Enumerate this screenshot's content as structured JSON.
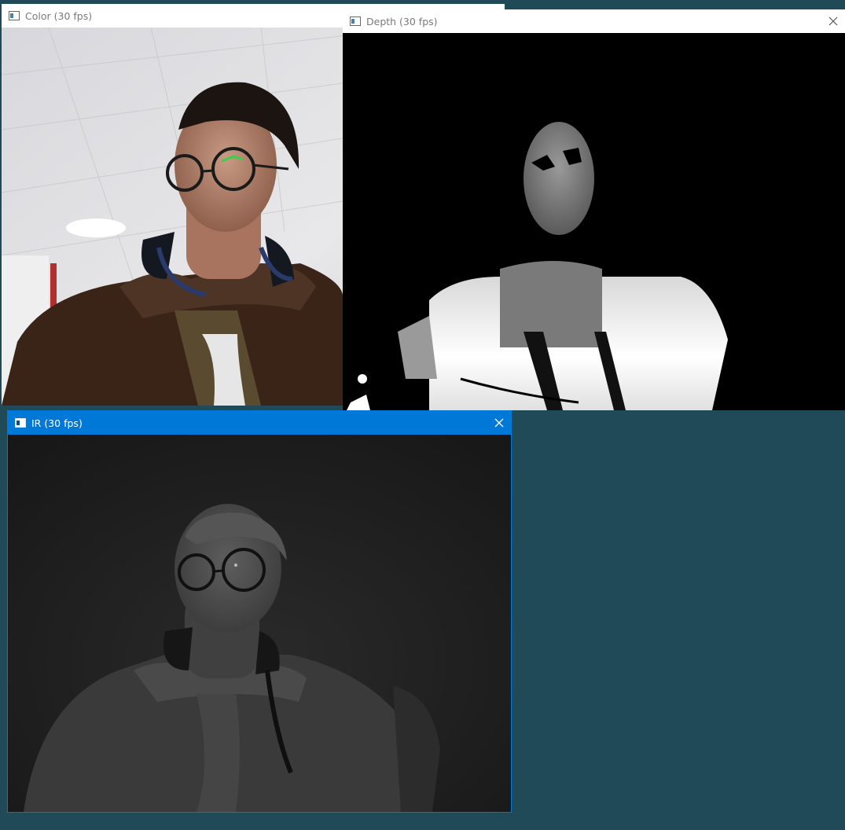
{
  "desktop": {
    "background_color": "#214a58"
  },
  "windows": {
    "color": {
      "title": "Color (30 fps)",
      "icon": "window-app-icon"
    },
    "depth": {
      "title": "Depth (30 fps)",
      "icon": "window-app-icon",
      "close_icon": "close-icon"
    },
    "ir": {
      "title": "IR (30 fps)",
      "icon": "window-app-icon",
      "close_icon": "close-icon",
      "active": true,
      "accent": "#0078d7"
    }
  }
}
